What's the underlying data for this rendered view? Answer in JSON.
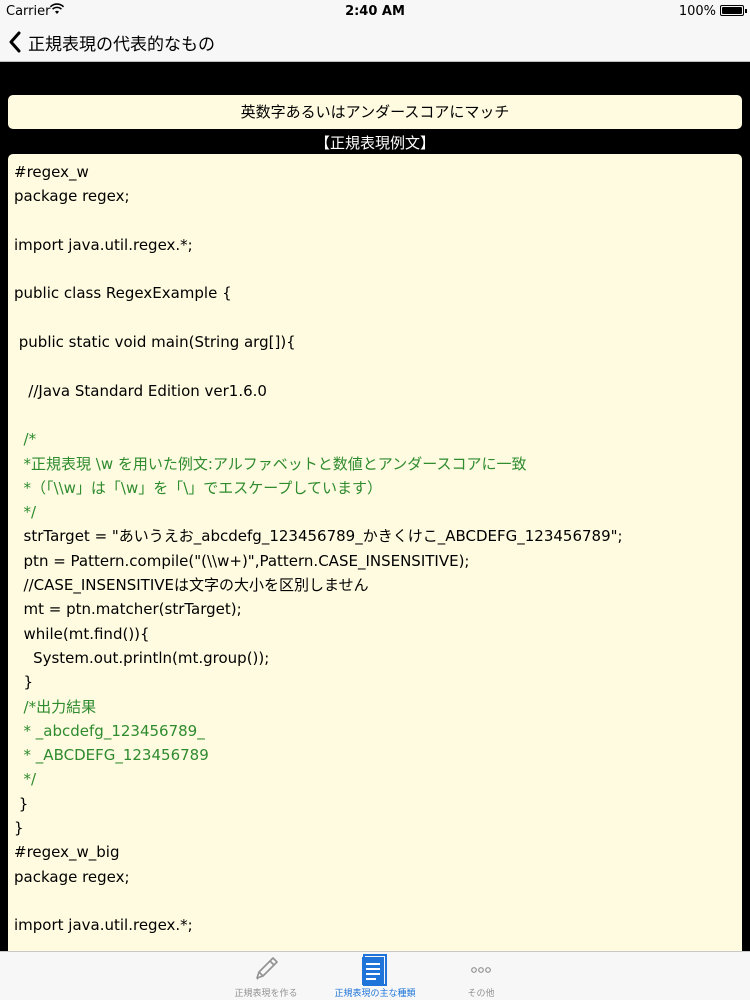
{
  "status_bar": {
    "carrier": "Carrier",
    "time": "2:40 AM",
    "battery": "100%"
  },
  "nav": {
    "back_label": "正規表現の代表的なもの"
  },
  "header_text": "英数字あるいはアンダースコアにマッチ",
  "section_label": "【正規表現例文】",
  "code_lines": [
    {
      "text": "#regex_w",
      "type": "code"
    },
    {
      "text": "package regex;",
      "type": "code"
    },
    {
      "text": "",
      "type": "code"
    },
    {
      "text": "import java.util.regex.*;",
      "type": "code"
    },
    {
      "text": "",
      "type": "code"
    },
    {
      "text": "public class RegexExample {",
      "type": "code"
    },
    {
      "text": "",
      "type": "code"
    },
    {
      "text": " public static void main(String arg[]){",
      "type": "code"
    },
    {
      "text": "",
      "type": "code"
    },
    {
      "text": "   //Java Standard Edition ver1.6.0",
      "type": "code"
    },
    {
      "text": "",
      "type": "code"
    },
    {
      "text": "  /*",
      "type": "comment"
    },
    {
      "text": "  *正規表現 \\w を用いた例文:アルファベットと数値とアンダースコアに一致",
      "type": "comment"
    },
    {
      "text": "  *（「\\\\w」は「\\w」を「\\」でエスケープしています）",
      "type": "comment"
    },
    {
      "text": "  */",
      "type": "comment"
    },
    {
      "text": "  strTarget = \"あいうえお_abcdefg_123456789_かきくけこ_ABCDEFG_123456789\";",
      "type": "code"
    },
    {
      "text": "  ptn = Pattern.compile(\"(\\\\w+)\",Pattern.CASE_INSENSITIVE);",
      "type": "code"
    },
    {
      "text": "  //CASE_INSENSITIVEは文字の大小を区別しません",
      "type": "code"
    },
    {
      "text": "  mt = ptn.matcher(strTarget);",
      "type": "code"
    },
    {
      "text": "  while(mt.find()){",
      "type": "code"
    },
    {
      "text": "    System.out.println(mt.group());",
      "type": "code"
    },
    {
      "text": "  }",
      "type": "code"
    },
    {
      "text": "  /*出力結果",
      "type": "comment"
    },
    {
      "text": "  * _abcdefg_123456789_",
      "type": "comment"
    },
    {
      "text": "  * _ABCDEFG_123456789",
      "type": "comment"
    },
    {
      "text": "  */",
      "type": "comment"
    },
    {
      "text": " }",
      "type": "code"
    },
    {
      "text": "}",
      "type": "code"
    },
    {
      "text": "#regex_w_big",
      "type": "code"
    },
    {
      "text": "package regex;",
      "type": "code"
    },
    {
      "text": "",
      "type": "code"
    },
    {
      "text": "import java.util.regex.*;",
      "type": "code"
    },
    {
      "text": "",
      "type": "code"
    }
  ],
  "tabs": [
    {
      "label": "正規表現を作る",
      "icon": "pencil-icon",
      "active": false
    },
    {
      "label": "正規表現の主な種類",
      "icon": "document-icon",
      "active": true
    },
    {
      "label": "その他",
      "icon": "more-icon",
      "active": false
    }
  ],
  "colors": {
    "panel_bg": "#fffbe0",
    "comment": "#2e8b2e",
    "tab_active": "#1e74d8",
    "tab_inactive": "#929292"
  }
}
